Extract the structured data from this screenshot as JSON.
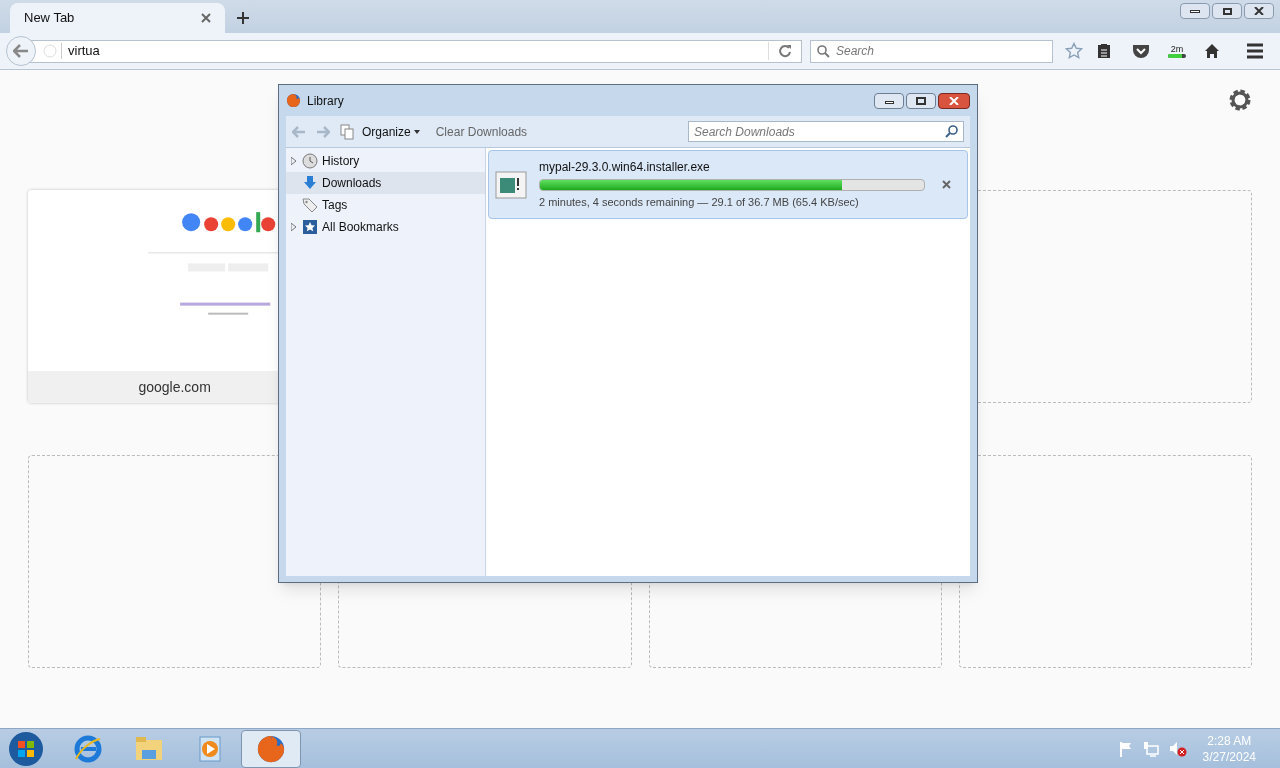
{
  "tab": {
    "title": "New Tab",
    "selected": true
  },
  "address_bar": {
    "value": "virtua"
  },
  "search_bar": {
    "placeholder": "Search"
  },
  "download_indicator": {
    "text": "2m",
    "level": 0.78
  },
  "tiles": [
    {
      "kind": "site",
      "label": "google.com"
    },
    {
      "kind": "empty"
    },
    {
      "kind": "empty"
    },
    {
      "kind": "empty"
    },
    {
      "kind": "empty"
    },
    {
      "kind": "empty"
    }
  ],
  "library": {
    "title": "Library",
    "organize": "Organize",
    "clear": "Clear Downloads",
    "search_placeholder": "Search Downloads",
    "sidebar": [
      {
        "label": "History",
        "kind": "history",
        "collapsible": true,
        "selected": false
      },
      {
        "label": "Downloads",
        "kind": "downloads",
        "collapsible": false,
        "selected": true
      },
      {
        "label": "Tags",
        "kind": "tags",
        "collapsible": false,
        "selected": false
      },
      {
        "label": "All Bookmarks",
        "kind": "bookmarks",
        "collapsible": true,
        "selected": false
      }
    ],
    "downloads": [
      {
        "name": "mypal-29.3.0.win64.installer.exe",
        "level": 0.787,
        "status": "2 minutes, 4 seconds remaining — 29.1 of 36.7 MB (65.4 KB/sec)",
        "selected": true
      }
    ]
  },
  "taskbar": {
    "apps": [
      {
        "kind": "browser",
        "active": false
      },
      {
        "kind": "explorer",
        "active": false
      },
      {
        "kind": "media",
        "active": false
      },
      {
        "kind": "firefox",
        "active": true
      }
    ],
    "time": "2:28 AM",
    "date": "3/27/2024"
  }
}
